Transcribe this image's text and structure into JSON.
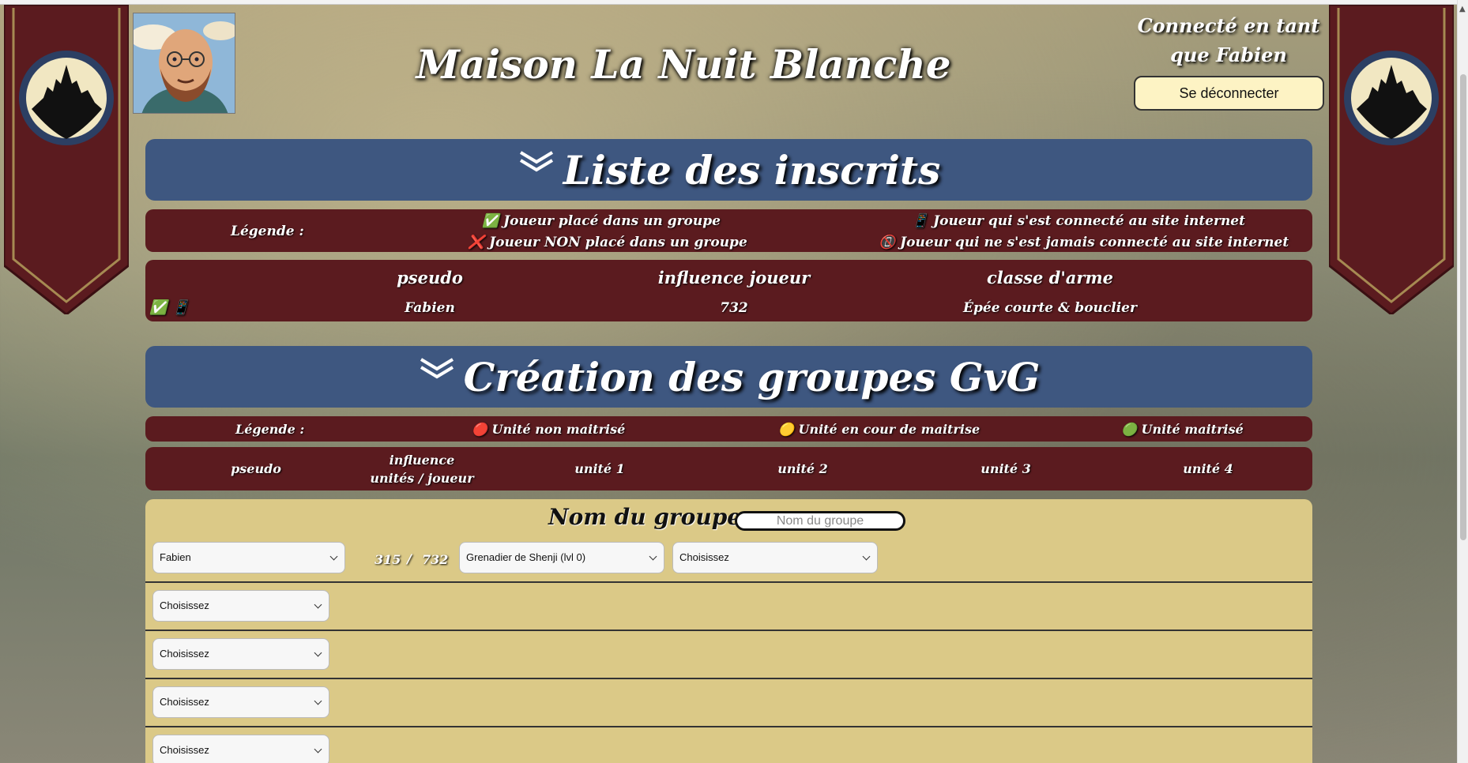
{
  "header": {
    "title": "Maison La Nuit Blanche",
    "login_text": "Connecté en tant que Fabien",
    "logout_label": "Se déconnecter"
  },
  "registered": {
    "heading": "Liste des inscrits",
    "legend_label": "Légende :",
    "legend": {
      "placed": "✅ Joueur placé dans un groupe",
      "not_placed": "❌ Joueur NON placé dans un groupe",
      "connected": "📱 Joueur qui s'est connecté au site internet",
      "never_connected": "📵 Joueur qui ne s'est jamais connecté au site internet"
    },
    "columns": [
      "pseudo",
      "influence joueur",
      "classe d'arme"
    ],
    "rows": [
      {
        "status": "✅ 📱",
        "pseudo": "Fabien",
        "influence": "732",
        "weapon": "Épée courte & bouclier"
      }
    ]
  },
  "gvg": {
    "heading": "Création des groupes GvG",
    "legend_label": "Légende :",
    "legend": {
      "not_mastered": "🔴 Unité non maitrisé",
      "in_progress": "🟡 Unité en cour de maitrise",
      "mastered": "🟢 Unité maitrisé"
    },
    "columns": {
      "pseudo": "pseudo",
      "influence_line1": "influence",
      "influence_line2": "unités / joueur",
      "unit1": "unité 1",
      "unit2": "unité 2",
      "unit3": "unité 3",
      "unit4": "unité 4"
    },
    "group_title": "Nom du groupe :",
    "group_name_placeholder": "Nom du groupe",
    "first_row": {
      "player": "Fabien",
      "units_influence": "315",
      "separator": "/",
      "player_influence": "732",
      "unit1": "Grenadier de Shenji (lvl 0)",
      "unit2": "Choisissez"
    },
    "empty_rows": [
      "Choisissez",
      "Choisissez",
      "Choisissez",
      "Choisissez"
    ]
  },
  "colors": {
    "section_blue": "#3e5780",
    "maroon": "#5b1b1f",
    "group_bg": "#dbc987",
    "logout_bg": "#fdf3c4"
  }
}
